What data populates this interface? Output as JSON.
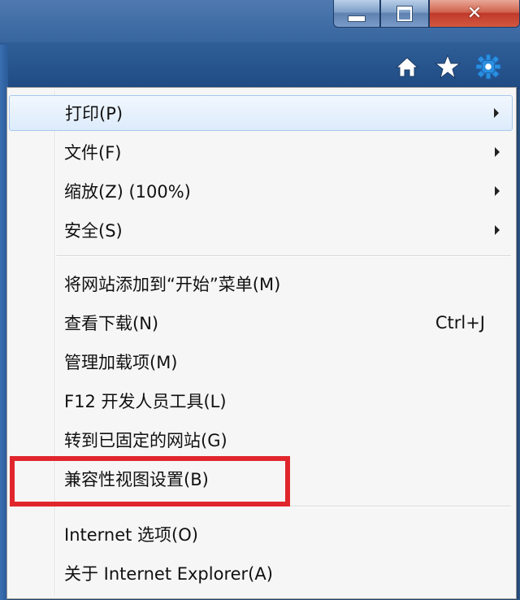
{
  "window": {
    "caption_buttons": {
      "minimize_icon": "minimize-icon",
      "maximize_icon": "maximize-icon",
      "close_icon": "close-icon",
      "close_glyph": "✕"
    },
    "toolbar_icons": [
      "home-icon",
      "star-icon",
      "gear-icon"
    ],
    "colors": {
      "accent": "#2f5d93",
      "highlight_frame": "#e0262c",
      "menu_hover": "#dcebfc"
    }
  },
  "menu": {
    "items": [
      {
        "label": "打印(P)",
        "submenu": true,
        "hover": true
      },
      {
        "label": "文件(F)",
        "submenu": true
      },
      {
        "label": "缩放(Z) (100%)",
        "submenu": true
      },
      {
        "label": "安全(S)",
        "submenu": true
      },
      {
        "label": "将网站添加到“开始”菜单(M)"
      },
      {
        "label": "查看下载(N)",
        "shortcut": "Ctrl+J"
      },
      {
        "label": "管理加载项(M)"
      },
      {
        "label": "F12 开发人员工具(L)"
      },
      {
        "label": "转到已固定的网站(G)"
      },
      {
        "label": "兼容性视图设置(B)",
        "highlighted": true
      },
      {
        "label": "Internet 选项(O)"
      },
      {
        "label": "关于 Internet Explorer(A)"
      }
    ]
  }
}
